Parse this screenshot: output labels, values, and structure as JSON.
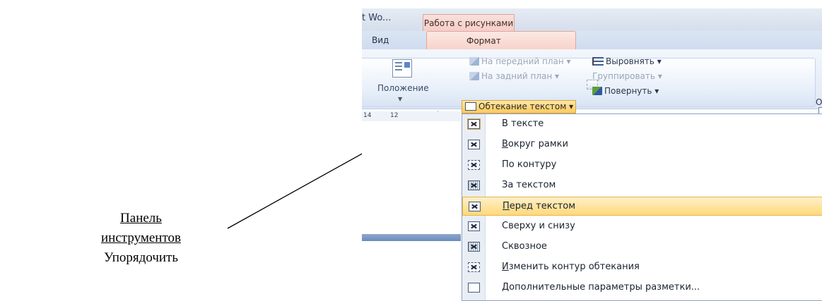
{
  "annotation": {
    "title": "Панель инструментов",
    "subtitle": "Упорядочить"
  },
  "titlebar": {
    "doc_title_fragment": "t Wo...",
    "context_tab": "Работа с рисунками"
  },
  "tabs": {
    "view": "Вид",
    "format": "Формат"
  },
  "ribbon": {
    "position_label": "Положение",
    "bring_front": "На передний план",
    "send_back": "На задний план",
    "text_wrapping": "Обтекание текстом",
    "align": "Выровнять",
    "group": "Группировать",
    "rotate": "Повернуть",
    "cut_label": "О"
  },
  "ruler": {
    "ticks": [
      "14",
      "12"
    ]
  },
  "wrap_menu": {
    "items": [
      {
        "label": "В тексте",
        "icon": "wrap-inline-icon"
      },
      {
        "label": "Вокруг рамки",
        "icon": "wrap-square-icon"
      },
      {
        "label": "По контуру",
        "icon": "wrap-tight-icon"
      },
      {
        "label": "За текстом",
        "icon": "wrap-behind-icon"
      },
      {
        "label": "Перед текстом",
        "icon": "wrap-front-icon",
        "highlighted": true
      },
      {
        "label": "Сверху и снизу",
        "icon": "wrap-topbottom-icon"
      },
      {
        "label": "Сквозное",
        "icon": "wrap-through-icon"
      },
      {
        "label": "Изменить контур обтекания",
        "icon": "edit-wrap-points-icon"
      },
      {
        "label": "Дополнительные параметры разметки...",
        "icon": "layout-options-icon"
      }
    ]
  },
  "colors": {
    "highlight": "#ffd97a",
    "context_tab": "#f3cfc8",
    "ribbon_blue": "#dfe8f5"
  }
}
